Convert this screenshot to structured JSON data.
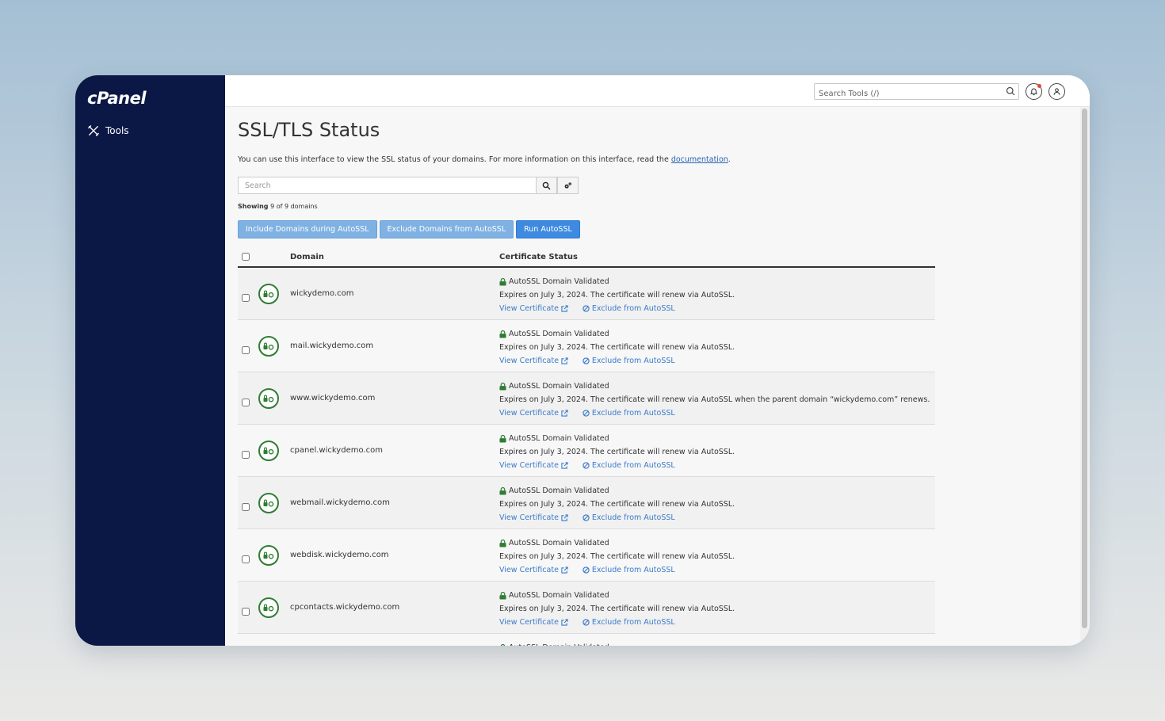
{
  "app": {
    "logo": "cPanel"
  },
  "sidebar": {
    "items": [
      {
        "label": "Tools",
        "icon": "tools-icon"
      }
    ]
  },
  "topbar": {
    "search_placeholder": "Search Tools (/)",
    "icons": [
      "search-icon",
      "bell-icon",
      "user-icon"
    ]
  },
  "page": {
    "title": "SSL/TLS Status",
    "intro_text": "You can use this interface to view the SSL status of your domains. For more information on this interface, read the",
    "intro_link": "documentation",
    "intro_end": ".",
    "search_placeholder": "Search",
    "showing_label": "Showing",
    "showing_text": "9 of 9 domains",
    "buttons": {
      "include": "Include Domains during AutoSSL",
      "exclude": "Exclude Domains from AutoSSL",
      "run": "Run AutoSSL"
    }
  },
  "table": {
    "headers": {
      "domain": "Domain",
      "status": "Certificate Status"
    },
    "rows": [
      {
        "domain": "wickydemo.com",
        "status": "AutoSSL Domain Validated",
        "detail": "Expires on July 3, 2024. The certificate will renew via AutoSSL.",
        "view": "View Certificate",
        "exclude": "Exclude from AutoSSL"
      },
      {
        "domain": "mail.wickydemo.com",
        "status": "AutoSSL Domain Validated",
        "detail": "Expires on July 3, 2024. The certificate will renew via AutoSSL.",
        "view": "View Certificate",
        "exclude": "Exclude from AutoSSL"
      },
      {
        "domain": "www.wickydemo.com",
        "status": "AutoSSL Domain Validated",
        "detail": "Expires on July 3, 2024. The certificate will renew via AutoSSL when the parent domain “wickydemo.com” renews.",
        "view": "View Certificate",
        "exclude": "Exclude from AutoSSL"
      },
      {
        "domain": "cpanel.wickydemo.com",
        "status": "AutoSSL Domain Validated",
        "detail": "Expires on July 3, 2024. The certificate will renew via AutoSSL.",
        "view": "View Certificate",
        "exclude": "Exclude from AutoSSL"
      },
      {
        "domain": "webmail.wickydemo.com",
        "status": "AutoSSL Domain Validated",
        "detail": "Expires on July 3, 2024. The certificate will renew via AutoSSL.",
        "view": "View Certificate",
        "exclude": "Exclude from AutoSSL"
      },
      {
        "domain": "webdisk.wickydemo.com",
        "status": "AutoSSL Domain Validated",
        "detail": "Expires on July 3, 2024. The certificate will renew via AutoSSL.",
        "view": "View Certificate",
        "exclude": "Exclude from AutoSSL"
      },
      {
        "domain": "cpcontacts.wickydemo.com",
        "status": "AutoSSL Domain Validated",
        "detail": "Expires on July 3, 2024. The certificate will renew via AutoSSL.",
        "view": "View Certificate",
        "exclude": "Exclude from AutoSSL"
      },
      {
        "domain": "",
        "status": "AutoSSL Domain Validated",
        "detail": "",
        "view": "",
        "exclude": ""
      }
    ]
  },
  "colors": {
    "sidebar": "#0b1845",
    "link": "#3b7ac9",
    "validated": "#2f7d32",
    "button_primary": "#3d8ae0",
    "button_light": "#7fb1e3"
  }
}
